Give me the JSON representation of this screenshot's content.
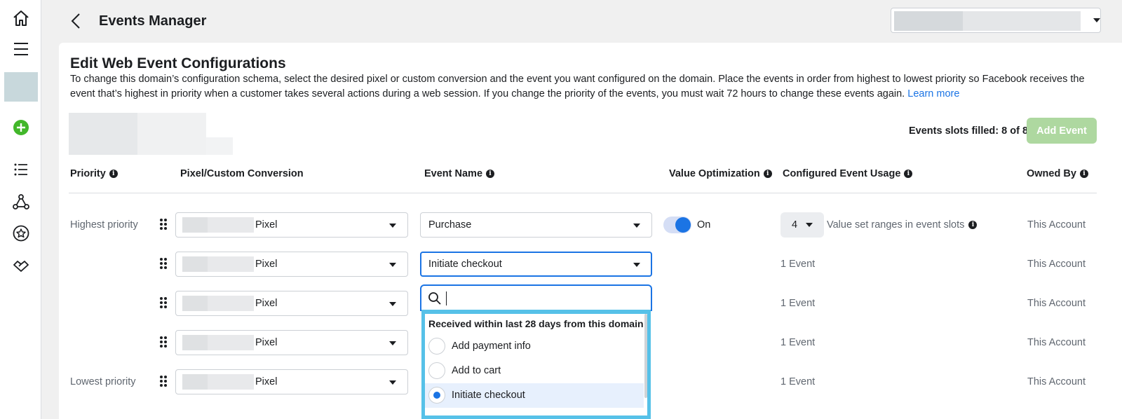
{
  "header": {
    "title": "Events Manager"
  },
  "nav": {
    "items": [
      "home-icon",
      "menu-icon",
      "add-icon",
      "list-icon",
      "graph-icon",
      "star-icon",
      "partner-icon"
    ]
  },
  "card": {
    "title": "Edit Web Event Configurations",
    "description": "To change this domain’s configuration schema, select the desired pixel or custom conversion and the event you want configured on the domain. Place the events in order from highest to lowest priority so Facebook receives the event that’s highest in priority when a customer takes several actions during a web session. If you change the priority of the events, you must wait 72 hours to change these events again.",
    "learn_more": "Learn more",
    "slots_text": "Events slots filled: 8 of 8",
    "add_event_label": "Add Event"
  },
  "columns": {
    "priority": "Priority",
    "pixel": "Pixel/Custom Conversion",
    "event_name": "Event Name",
    "value_opt": "Value Optimization",
    "usage": "Configured Event Usage",
    "owned_by": "Owned By"
  },
  "rows": [
    {
      "priority_label": "Highest priority",
      "pixel": "Pixel",
      "event": "Purchase",
      "value_opt": "On",
      "usage_num": "4",
      "usage_text": "Value set ranges in event slots",
      "owned": "This Account"
    },
    {
      "priority_label": "",
      "pixel": "Pixel",
      "event": "Initiate checkout",
      "usage_text": "1 Event",
      "owned": "This Account"
    },
    {
      "priority_label": "",
      "pixel": "Pixel",
      "usage_text": "1 Event",
      "owned": "This Account"
    },
    {
      "priority_label": "",
      "pixel": "Pixel",
      "usage_text": "1 Event",
      "owned": "This Account"
    },
    {
      "priority_label": "Lowest priority",
      "pixel": "Pixel",
      "usage_text": "1 Event",
      "owned": "This Account"
    }
  ],
  "dropdown": {
    "search_value": "",
    "heading": "Received within last 28 days from this domain",
    "options": [
      {
        "label": "Add payment info",
        "selected": false
      },
      {
        "label": "Add to cart",
        "selected": false
      },
      {
        "label": "Initiate checkout",
        "selected": true
      }
    ]
  },
  "colors": {
    "accent": "#1b74e4",
    "add_event_disabled": "#aed8a0",
    "popover_highlight": "#56c1e8",
    "nav_add": "#42b72a"
  }
}
